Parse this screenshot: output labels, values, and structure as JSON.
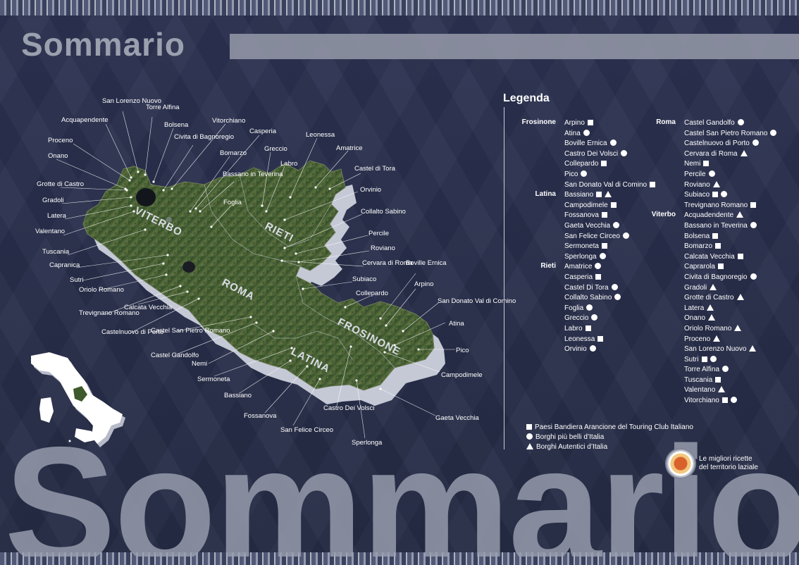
{
  "header": {
    "title": "Sommario"
  },
  "background_word": "Sommario",
  "regions": [
    "VITERBO",
    "RIETI",
    "ROMA",
    "FROSINONE",
    "LATINA"
  ],
  "map_labels": [
    "San Lorenzo Nuovo",
    "Torre Alfina",
    "Acquapendente",
    "Bolsena",
    "Vitorchiano",
    "Civita di Bagnoregio",
    "Casperia",
    "Proceno",
    "Bomarzo",
    "Greccio",
    "Leonessa",
    "Amatrice",
    "Onano",
    "Labro",
    "Bassano in Teverina",
    "Castel di Tora",
    "Grotte di Castro",
    "Orvinio",
    "Gradoli",
    "Foglia",
    "Latera",
    "Collalto Sabino",
    "Valentano",
    "Percile",
    "Tuscania",
    "Roviano",
    "Capranica",
    "Cervara di Roma",
    "Boville Ernica",
    "Sutri",
    "Subiaco",
    "Oriolo Romano",
    "Arpino",
    "Collepardo",
    "Trevignano Romano",
    "Calcata Vecchia",
    "San Donato Val di Comino",
    "Castelnuovo di Porto",
    "Castel San Pietro Romano",
    "Atina",
    "Castel Gandolfo",
    "Nemi",
    "Pico",
    "Sermoneta",
    "Campodimele",
    "Bassiano",
    "Castro Dei Volsci",
    "Fossanova",
    "Gaeta Vecchia",
    "San Felice Circeo",
    "Sperlonga"
  ],
  "legend": {
    "title": "Legenda",
    "left_column": [
      {
        "province": "Frosinone",
        "items": [
          {
            "name": "Arpino",
            "symbols": [
              "square"
            ]
          },
          {
            "name": "Atina",
            "symbols": [
              "circle"
            ]
          },
          {
            "name": "Boville Ernica",
            "symbols": [
              "circle"
            ]
          },
          {
            "name": "Castro Dei Volsci",
            "symbols": [
              "circle"
            ]
          },
          {
            "name": "Collepardo",
            "symbols": [
              "square"
            ]
          },
          {
            "name": "Pico",
            "symbols": [
              "circle"
            ]
          },
          {
            "name": "San Donato Val di Comino",
            "symbols": [
              "square"
            ]
          }
        ]
      },
      {
        "province": "Latina",
        "items": [
          {
            "name": "Bassiano",
            "symbols": [
              "square",
              "triangle"
            ]
          },
          {
            "name": "Campodimele",
            "symbols": [
              "square"
            ]
          },
          {
            "name": "Fossanova",
            "symbols": [
              "square"
            ]
          },
          {
            "name": "Gaeta Vecchia",
            "symbols": [
              "circle"
            ]
          },
          {
            "name": "San Felice Circeo",
            "symbols": [
              "circle"
            ]
          },
          {
            "name": "Sermoneta",
            "symbols": [
              "square"
            ]
          },
          {
            "name": "Sperlonga",
            "symbols": [
              "circle"
            ]
          }
        ]
      },
      {
        "province": "Rieti",
        "items": [
          {
            "name": "Amatrice",
            "symbols": [
              "circle"
            ]
          },
          {
            "name": "Casperia",
            "symbols": [
              "square"
            ]
          },
          {
            "name": "Castel Di Tora",
            "symbols": [
              "circle"
            ]
          },
          {
            "name": "Collalto Sabino",
            "symbols": [
              "circle"
            ]
          },
          {
            "name": "Foglia",
            "symbols": [
              "circle"
            ]
          },
          {
            "name": "Greccio",
            "symbols": [
              "circle"
            ]
          },
          {
            "name": "Labro",
            "symbols": [
              "square"
            ]
          },
          {
            "name": "Leonessa",
            "symbols": [
              "square"
            ]
          },
          {
            "name": "Orvinio",
            "symbols": [
              "circle"
            ]
          }
        ]
      }
    ],
    "right_column": [
      {
        "province": "Roma",
        "items": [
          {
            "name": "Castel Gandolfo",
            "symbols": [
              "circle"
            ]
          },
          {
            "name": "Castel San Pietro Romano",
            "symbols": [
              "circle"
            ]
          },
          {
            "name": "Castelnuovo di Porto",
            "symbols": [
              "circle"
            ]
          },
          {
            "name": "Cervara di Roma",
            "symbols": [
              "triangle"
            ]
          },
          {
            "name": "Nemi",
            "symbols": [
              "square"
            ]
          },
          {
            "name": "Percile",
            "symbols": [
              "circle"
            ]
          },
          {
            "name": "Roviano",
            "symbols": [
              "triangle"
            ]
          },
          {
            "name": "Subiaco",
            "symbols": [
              "square",
              "circle"
            ]
          },
          {
            "name": "Trevignano Romano",
            "symbols": [
              "square"
            ]
          }
        ]
      },
      {
        "province": "Viterbo",
        "items": [
          {
            "name": "Acquadendente",
            "symbols": [
              "triangle"
            ]
          },
          {
            "name": "Bassano in Teverina",
            "symbols": [
              "circle"
            ]
          },
          {
            "name": "Bolsena",
            "symbols": [
              "square"
            ]
          },
          {
            "name": "Bomarzo",
            "symbols": [
              "square"
            ]
          },
          {
            "name": "Calcata Vecchia",
            "symbols": [
              "square"
            ]
          },
          {
            "name": "Caprarola",
            "symbols": [
              "square"
            ]
          },
          {
            "name": "Civita di Bagnoregio",
            "symbols": [
              "circle"
            ]
          },
          {
            "name": "Gradoli",
            "symbols": [
              "triangle"
            ]
          },
          {
            "name": "Grotte di Castro",
            "symbols": [
              "triangle"
            ]
          },
          {
            "name": "Latera",
            "symbols": [
              "triangle"
            ]
          },
          {
            "name": "Onano",
            "symbols": [
              "triangle"
            ]
          },
          {
            "name": "Oriolo Romano",
            "symbols": [
              "triangle"
            ]
          },
          {
            "name": "Proceno",
            "symbols": [
              "triangle"
            ]
          },
          {
            "name": "San Lorenzo Nuovo",
            "symbols": [
              "triangle"
            ]
          },
          {
            "name": "Sutri",
            "symbols": [
              "square",
              "circle"
            ]
          },
          {
            "name": "Torre Alfina",
            "symbols": [
              "circle"
            ]
          },
          {
            "name": "Tuscania",
            "symbols": [
              "square"
            ]
          },
          {
            "name": "Valentano",
            "symbols": [
              "triangle"
            ]
          },
          {
            "name": "Vitorchiano",
            "symbols": [
              "square",
              "circle"
            ]
          }
        ]
      }
    ],
    "key": [
      {
        "symbol": "square",
        "text": "Paesi Bandiera Arancione del Touring Club Italiano"
      },
      {
        "symbol": "circle",
        "text": "Borghi più belli d’Italia"
      },
      {
        "symbol": "triangle",
        "text": "Borghi Autentici d’Italia"
      }
    ]
  },
  "recipe_note": {
    "line1": "Le migliori ricette",
    "line2": "del territorio laziale"
  },
  "colors": {
    "background": "#262c45",
    "map_green": "#3e5a2c",
    "extrusion": "#c9ccd8",
    "title_gray": "#9aa0ad"
  }
}
